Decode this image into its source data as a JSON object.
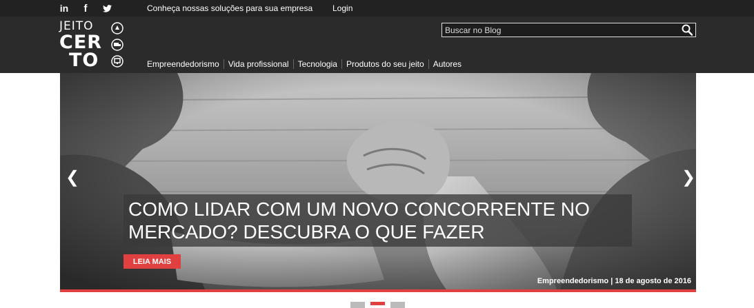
{
  "topbar": {
    "social_icons": [
      "linkedin-icon",
      "facebook-icon",
      "twitter-icon"
    ],
    "social_text": {
      "linkedin": "in",
      "facebook": "f"
    },
    "solutions_link": "Conheça nossas soluções para sua empresa",
    "login_link": "Login"
  },
  "logo": {
    "line1": "JEITO",
    "line2": "CER",
    "line3": "TO"
  },
  "search": {
    "placeholder": "Buscar no Blog",
    "value": ""
  },
  "nav": {
    "items": [
      "Empreendedorismo",
      "Vida profissional",
      "Tecnologia",
      "Produtos do seu jeito",
      "Autores"
    ]
  },
  "hero": {
    "title": "COMO LIDAR COM UM NOVO CONCORRENTE NO MERCADO? DESCUBRA O QUE FAZER",
    "read_more": "LEIA MAIS",
    "meta": "Empreendedorismo | 18 de agosto de 2016",
    "prev_arrow": "❮",
    "next_arrow": "❯"
  },
  "carousel": {
    "slide_count": 3,
    "active_index": 1
  },
  "colors": {
    "accent": "#e04040",
    "header_bg": "#2b2b2b",
    "topbar_bg": "#222222"
  }
}
